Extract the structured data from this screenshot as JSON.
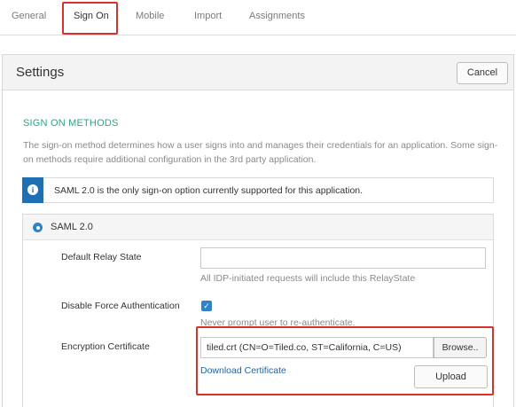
{
  "tabs": [
    {
      "label": "General"
    },
    {
      "label": "Sign On"
    },
    {
      "label": "Mobile"
    },
    {
      "label": "Import"
    },
    {
      "label": "Assignments"
    }
  ],
  "active_tab": "Sign On",
  "colors": {
    "highlight_red": "#d9322b",
    "accent_green": "#2aa389",
    "primary_blue": "#2f84c9",
    "info_blue": "#1f6fb4",
    "link_blue": "#2263a3"
  },
  "settings": {
    "title": "Settings",
    "cancel_label": "Cancel"
  },
  "sign_on": {
    "section_title": "SIGN ON METHODS",
    "description": "The sign-on method determines how a user signs into and manages their credentials for an application. Some sign-on methods require additional configuration in the 3rd party application.",
    "info_icon": "info-icon",
    "info_text": "SAML 2.0 is the only sign-on option currently supported for this application.",
    "method": {
      "label": "SAML 2.0",
      "selected": true
    }
  },
  "fields": {
    "relay_state": {
      "label": "Default Relay State",
      "value": "",
      "hint": "All IDP-initiated requests will include this RelayState"
    },
    "force_auth": {
      "label": "Disable Force Authentication",
      "checked": true,
      "hint": "Never prompt user to re-authenticate."
    },
    "encryption_cert": {
      "label": "Encryption Certificate",
      "value": "tiled.crt (CN=O=Tiled.co, ST=California, C=US)",
      "browse_label": "Browse..",
      "download_label": "Download Certificate",
      "upload_label": "Upload"
    }
  }
}
